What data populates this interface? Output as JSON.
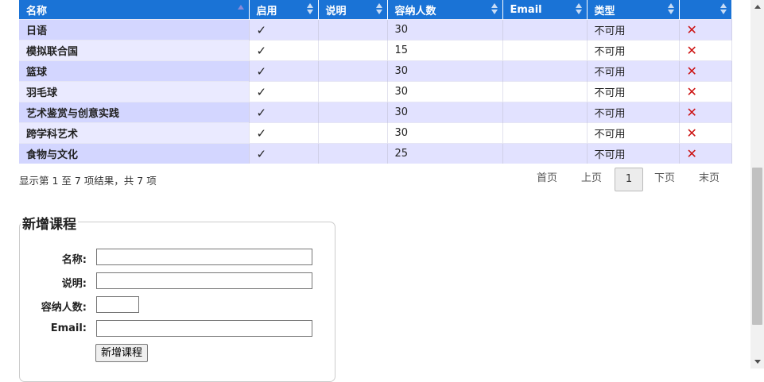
{
  "table": {
    "headers": [
      "名称",
      "启用",
      "说明",
      "容纳人数",
      "Email",
      "类型",
      ""
    ],
    "rows": [
      {
        "name": "日语",
        "enabled": "✓",
        "desc": "",
        "capacity": "30",
        "email": "",
        "type": "不可用"
      },
      {
        "name": "模拟联合国",
        "enabled": "✓",
        "desc": "",
        "capacity": "15",
        "email": "",
        "type": "不可用"
      },
      {
        "name": "篮球",
        "enabled": "✓",
        "desc": "",
        "capacity": "30",
        "email": "",
        "type": "不可用"
      },
      {
        "name": "羽毛球",
        "enabled": "✓",
        "desc": "",
        "capacity": "30",
        "email": "",
        "type": "不可用"
      },
      {
        "name": "艺术鉴赏与创意实践",
        "enabled": "✓",
        "desc": "",
        "capacity": "30",
        "email": "",
        "type": "不可用"
      },
      {
        "name": "跨学科艺术",
        "enabled": "✓",
        "desc": "",
        "capacity": "30",
        "email": "",
        "type": "不可用"
      },
      {
        "name": "食物与文化",
        "enabled": "✓",
        "desc": "",
        "capacity": "25",
        "email": "",
        "type": "不可用"
      }
    ],
    "delete_icon": "close-x-icon"
  },
  "info": "显示第 1 至 7 项结果，共 7 项",
  "pager": {
    "first": "首页",
    "prev": "上页",
    "current": "1",
    "next": "下页",
    "last": "末页"
  },
  "form": {
    "legend": "新增课程",
    "name_label": "名称:",
    "desc_label": "说明:",
    "capacity_label": "容纳人数:",
    "email_label": "Email:",
    "name_value": "",
    "desc_value": "",
    "capacity_value": "",
    "email_value": "",
    "submit": "新增课程"
  },
  "colors": {
    "header_bg": "#1a73d6",
    "row_alt": "#e2e2ff",
    "delete": "#cc1111"
  }
}
